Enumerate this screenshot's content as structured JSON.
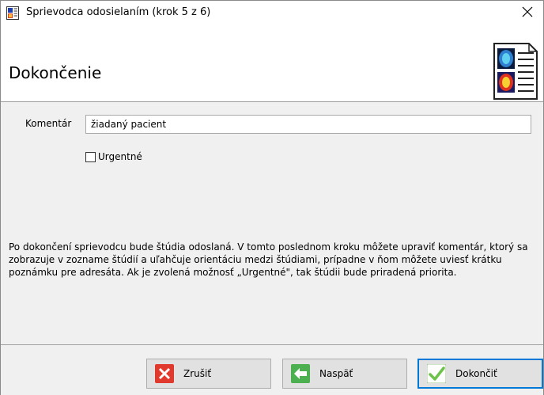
{
  "window": {
    "title": "Sprievodca odosielaním (krok 5 z 6)"
  },
  "header": {
    "title": "Dokončenie"
  },
  "form": {
    "comment_label": "Komentár",
    "comment_value": "žiadaný pacient",
    "urgent_label": "Urgentné",
    "urgent_checked": false
  },
  "description": "Po dokončení sprievodcu bude štúdia odoslaná. V tomto poslednom kroku môžete upraviť komentár, ktorý sa zobrazuje v zozname štúdií a uľahčuje orientáciu medzi štúdiami, prípadne v ňom môžete uviesť krátku poznámku pre adresáta. Ak je zvolená možnosť „Urgentné\", tak štúdii bude priradená priorita.",
  "buttons": {
    "cancel": "Zrušiť",
    "back": "Naspäť",
    "finish": "Dokončiť"
  },
  "icons": {
    "app": "study-document-icon",
    "header": "medical-scan-document-icon",
    "close": "close-icon",
    "cancel": "red-x-icon",
    "back": "green-left-arrow-icon",
    "finish": "green-checkmark-icon"
  },
  "colors": {
    "cancel_icon": "#e03a2f",
    "back_icon": "#4caf50",
    "finish_icon": "#6cc24a",
    "focus_border": "#0078d7"
  }
}
